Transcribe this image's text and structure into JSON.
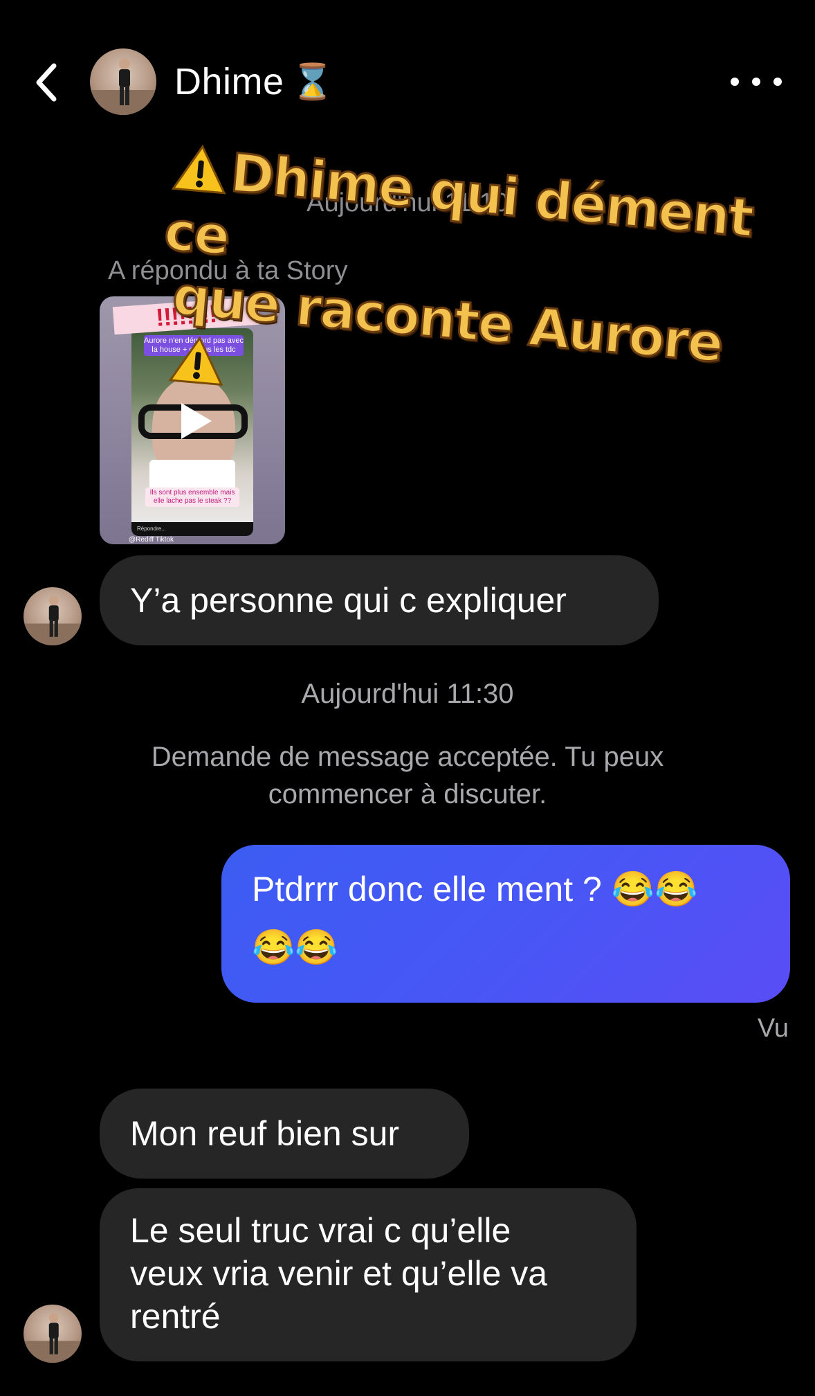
{
  "header": {
    "contact_name": "Dhime",
    "status_emoji": "⌛"
  },
  "overlay": {
    "line1": "Dhime qui dément ce",
    "line2": "que raconte Aurore",
    "icon": "warning-icon",
    "color": "#f2c14e"
  },
  "thread": {
    "hidden_timestamp": "Aujourd'hui 11:10",
    "story_reply_label": "A répondu à ta Story",
    "story": {
      "banner": "!!!!!!!!",
      "caption_top": "Aurore n'en démord pas avec la house + c nous les tdc",
      "caption_bottom": "Ils sont plus ensemble mais elle lache pas le steak ??",
      "reply_hint": "Répondre...",
      "credit": "@Rediff Tiktok"
    },
    "msg1": "Y’a personne qui c expliquer",
    "timestamp": "Aujourd'hui 11:30",
    "system_line1": "Demande de message acceptée. Tu peux",
    "system_line2": "commencer à discuter.",
    "outgoing_text": "Ptdrrr donc elle ment ?",
    "outgoing_emoji": "😂",
    "seen": "Vu",
    "msg2": "Mon reuf bien sur",
    "msg3_line1": "Le seul truc vrai c qu’elle",
    "msg3_line2": "veux vria venir et qu’elle va",
    "msg3_line3": "rentré"
  },
  "colors": {
    "background": "#000000",
    "incoming_bubble": "#262626",
    "outgoing_bubble": "#4757f6",
    "meta_text": "#a8a8ad"
  }
}
